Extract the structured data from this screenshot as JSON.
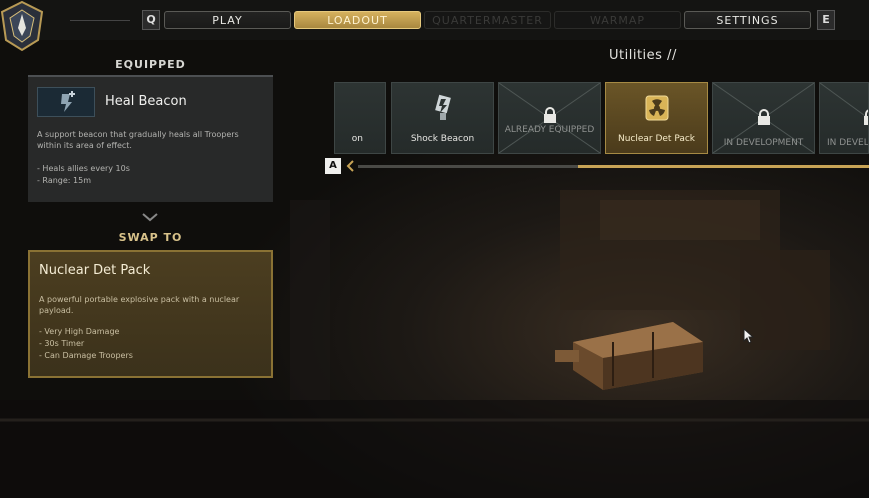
{
  "topbar": {
    "left_key": "Q",
    "right_key": "E",
    "tabs": [
      {
        "label": "PLAY",
        "state": "normal"
      },
      {
        "label": "LOADOUT",
        "state": "active"
      },
      {
        "label": "QUARTERMASTER",
        "state": "disabled"
      },
      {
        "label": "WARMAP",
        "state": "disabled"
      },
      {
        "label": "SETTINGS",
        "state": "normal"
      }
    ]
  },
  "equipped": {
    "header": "EQUIPPED",
    "name": "Heal Beacon",
    "description": "A support beacon that gradually heals all Troopers within its area of effect.",
    "stats": [
      "- Heals allies every 10s",
      "- Range: 15m"
    ]
  },
  "swap": {
    "header": "SWAP TO",
    "name": "Nuclear Det Pack",
    "description": "A powerful portable explosive pack with a nuclear payload.",
    "stats": [
      "- Very High Damage",
      "- 30s Timer",
      "- Can Damage Troopers"
    ]
  },
  "utilities": {
    "title": "Utilities //",
    "cards": [
      {
        "label": "on",
        "status": "partial"
      },
      {
        "label": "Shock Beacon",
        "status": "available",
        "icon": "shock-beacon-icon"
      },
      {
        "label": "ALREADY EQUIPPED",
        "status": "equipped",
        "icon": "heal-beacon-icon"
      },
      {
        "label": "Nuclear Det Pack",
        "status": "selected",
        "icon": "nuclear-det-pack-icon"
      },
      {
        "label": "IN DEVELOPMENT",
        "status": "locked",
        "icon": "lock-icon"
      },
      {
        "label": "IN DEVEL",
        "status": "locked",
        "icon": "lock-icon"
      }
    ],
    "scroll_key": "A",
    "scroll_position": 0.43
  },
  "colors": {
    "accent_gold": "#c8a456",
    "panel_dark": "#2a2b2c",
    "swap_panel": "#4c3e20"
  }
}
